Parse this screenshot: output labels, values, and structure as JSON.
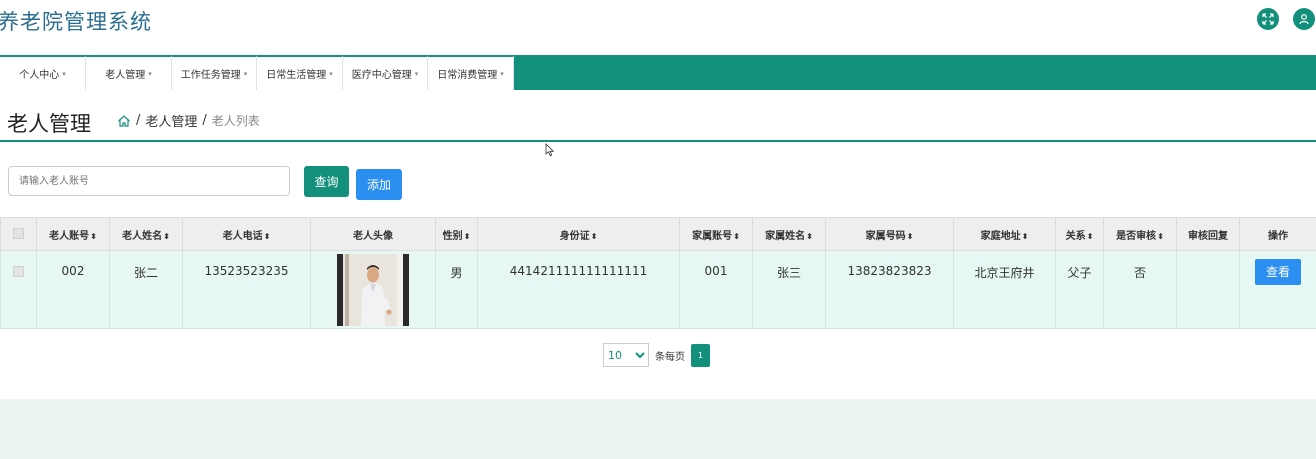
{
  "app": {
    "title": "养老院管理系统"
  },
  "top_icons": [
    {
      "icon": "expand-icon"
    },
    {
      "icon": "user-icon"
    }
  ],
  "nav": {
    "items": [
      {
        "label": "个人中心"
      },
      {
        "label": "老人管理"
      },
      {
        "label": "工作任务管理"
      },
      {
        "label": "日常生活管理"
      },
      {
        "label": "医疗中心管理"
      },
      {
        "label": "日常消费管理"
      }
    ]
  },
  "page": {
    "title": "老人管理",
    "breadcrumb": {
      "separator": "/",
      "parent": "老人管理",
      "current": "老人列表"
    }
  },
  "search": {
    "placeholder": "请输入老人账号",
    "value": "",
    "search_label": "查询",
    "add_label": "添加"
  },
  "table": {
    "columns": [
      {
        "label": "老人账号",
        "sortable": true
      },
      {
        "label": "老人姓名",
        "sortable": true
      },
      {
        "label": "老人电话",
        "sortable": true
      },
      {
        "label": "老人头像",
        "sortable": false
      },
      {
        "label": "性别",
        "sortable": true
      },
      {
        "label": "身份证",
        "sortable": true
      },
      {
        "label": "家属账号",
        "sortable": true
      },
      {
        "label": "家属姓名",
        "sortable": true
      },
      {
        "label": "家属号码",
        "sortable": true
      },
      {
        "label": "家庭地址",
        "sortable": true
      },
      {
        "label": "关系",
        "sortable": true
      },
      {
        "label": "是否审核",
        "sortable": true
      },
      {
        "label": "审核回复",
        "sortable": false
      },
      {
        "label": "操作",
        "sortable": false
      }
    ],
    "rows": [
      {
        "account": "002",
        "name": "张二",
        "phone": "13523523235",
        "gender": "男",
        "id_card": "441421111111111111",
        "family_account": "001",
        "family_name": "张三",
        "family_phone": "13823823823",
        "address": "北京王府井",
        "relation": "父子",
        "reviewed": "否",
        "review_reply": "",
        "action_label": "查看"
      }
    ]
  },
  "pagination": {
    "page_size": "10",
    "per_page_label": "条每页",
    "current_page": "1"
  },
  "colors": {
    "primary": "#13907c",
    "button_blue": "#2a8ff0",
    "row_bg": "#e6f7f4"
  }
}
